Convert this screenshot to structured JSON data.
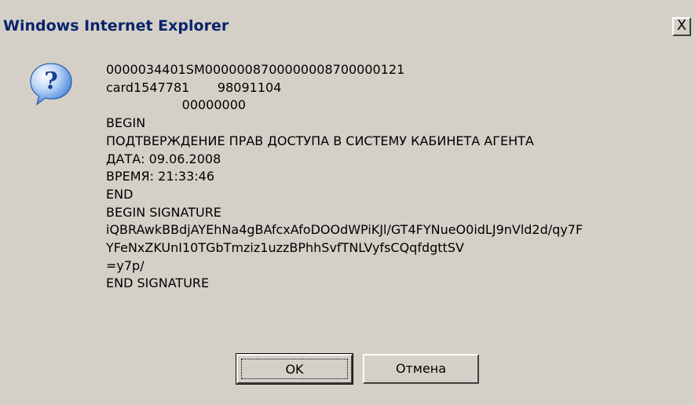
{
  "window": {
    "title": "Windows Internet Explorer",
    "close_label": "X"
  },
  "icon": {
    "name": "question-icon",
    "glyph": "?"
  },
  "message": {
    "lines": [
      "0000034401SM0000008700000008700000121",
      "card1547781       98091104",
      "                   00000000",
      "BEGIN",
      "ПОДТВЕРЖДЕНИЕ ПРАВ ДОСТУПА В СИСТЕМУ КАБИНЕТА АГЕНТА",
      "ДАТА: 09.06.2008",
      "ВРЕМЯ: 21:33:46",
      "END",
      "BEGIN SIGNATURE",
      "iQBRAwkBBdjAYEhNa4gBAfcxAfoDOOdWPiKJl/GT4FYNueO0idLJ9nVld2d/qy7F",
      "YFeNxZKUnI10TGbTmziz1uzzBPhhSvfTNLVyfsCQqfdgttSV",
      "=y7p/",
      "END SIGNATURE"
    ]
  },
  "buttons": {
    "ok_label": "OK",
    "cancel_label": "Отмена"
  },
  "colors": {
    "dialog_bg": "#d4d0c8",
    "title_text": "#0a246a",
    "icon_bubble": "#3b7bd6"
  }
}
